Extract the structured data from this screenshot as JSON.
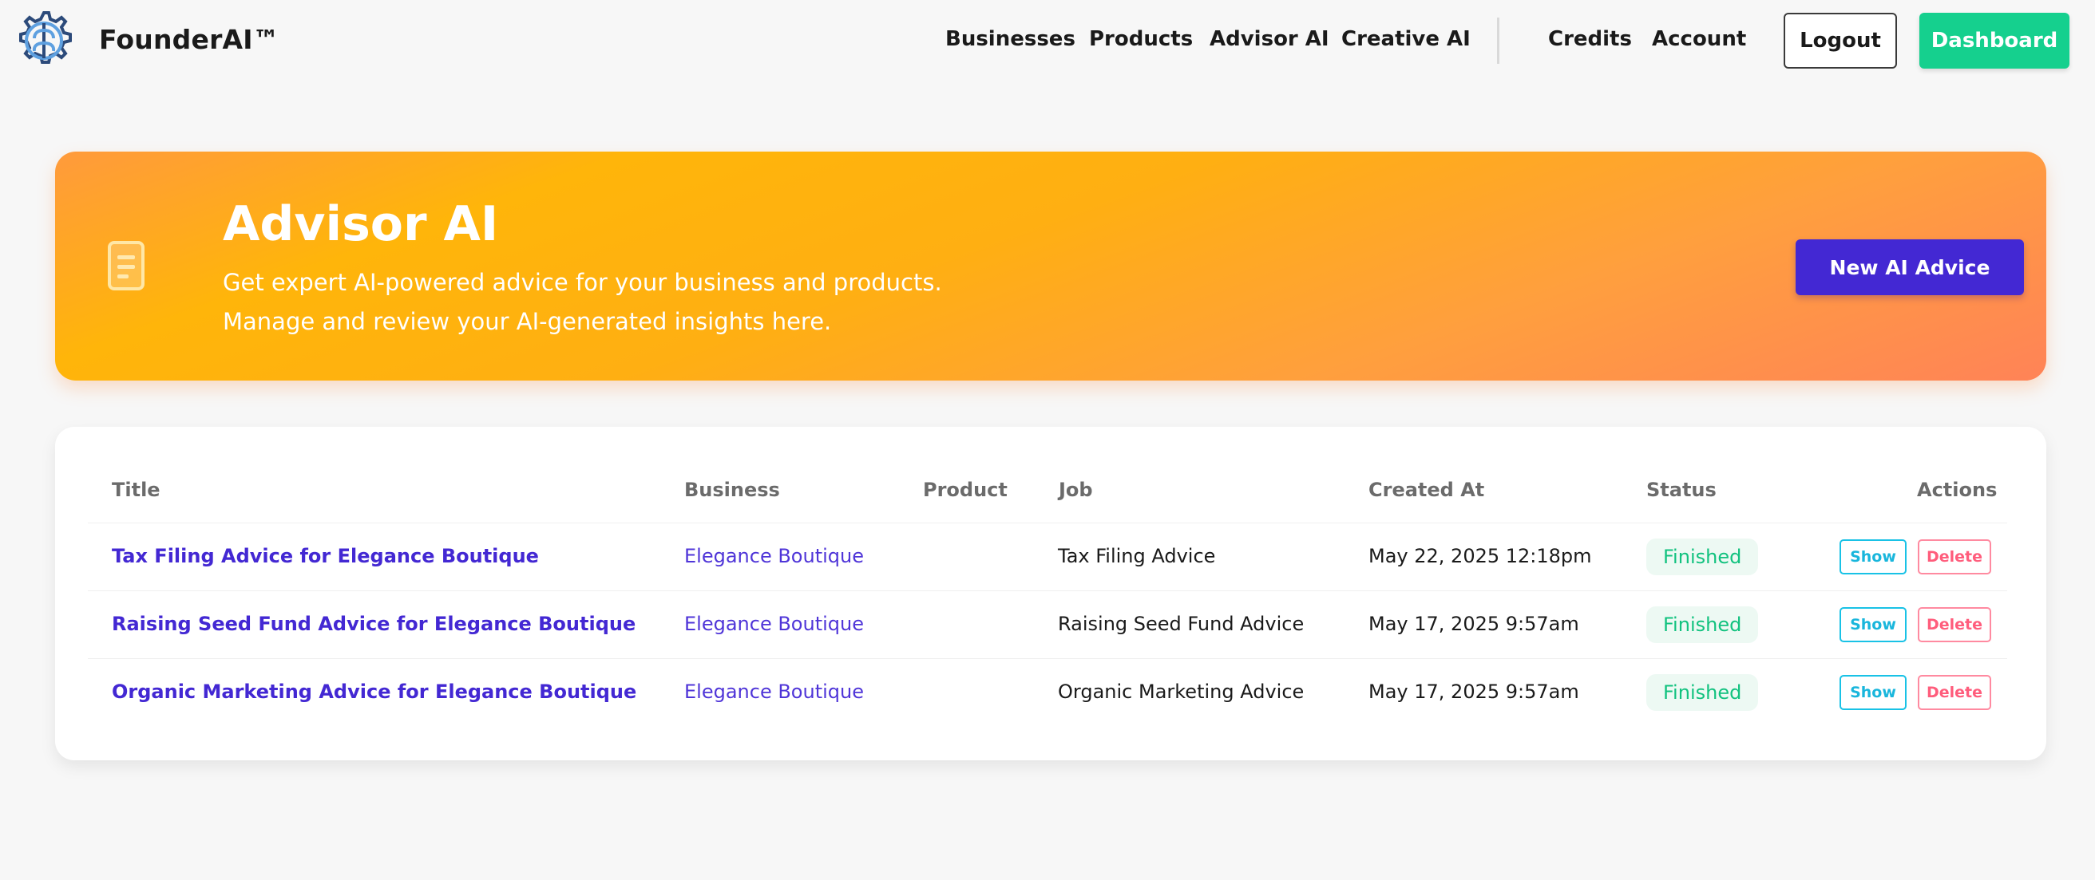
{
  "header": {
    "brand": "FounderAI™",
    "logo_icon": "brain-gear-icon",
    "nav": [
      "Businesses",
      "Products",
      "Advisor AI",
      "Creative AI"
    ],
    "nav_secondary": [
      "Credits",
      "Account"
    ],
    "logout_label": "Logout",
    "dashboard_label": "Dashboard"
  },
  "hero": {
    "icon": "document-icon",
    "title": "Advisor AI",
    "subtitle_line1": "Get expert AI-powered advice for your business and products.",
    "subtitle_line2": "Manage and review your AI-generated insights here.",
    "cta_label": "New AI Advice"
  },
  "table": {
    "headers": [
      "Title",
      "Business",
      "Product",
      "Job",
      "Created At",
      "Status",
      "Actions"
    ],
    "rows": [
      {
        "title": "Tax Filing Advice for Elegance Boutique",
        "business": "Elegance Boutique",
        "product": "",
        "job": "Tax Filing Advice",
        "created_at": "May 22, 2025 12:18pm",
        "status": "Finished",
        "show_label": "Show",
        "delete_label": "Delete"
      },
      {
        "title": "Raising Seed Fund Advice for Elegance Boutique",
        "business": "Elegance Boutique",
        "product": "",
        "job": "Raising Seed Fund Advice",
        "created_at": "May 17, 2025 9:57am",
        "status": "Finished",
        "show_label": "Show",
        "delete_label": "Delete"
      },
      {
        "title": "Organic Marketing Advice for Elegance Boutique",
        "business": "Elegance Boutique",
        "product": "",
        "job": "Organic Marketing Advice",
        "created_at": "May 17, 2025 9:57am",
        "status": "Finished",
        "show_label": "Show",
        "delete_label": "Delete"
      }
    ]
  },
  "colors": {
    "accent_purple": "#4328d3",
    "accent_green": "#15d08e",
    "status_green": "#12c27f",
    "show_cyan": "#19c2e6",
    "delete_pink": "#ff5d7c",
    "hero_orange": "#ffb50a"
  }
}
